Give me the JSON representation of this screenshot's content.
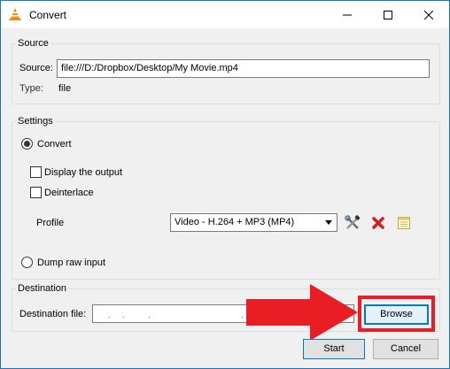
{
  "window": {
    "title": "Convert",
    "accent_color": "#e81e24"
  },
  "source": {
    "legend": "Source",
    "source_label": "Source:",
    "source_value": "file:///D:/Dropbox/Desktop/My Movie.mp4",
    "type_label": "Type:",
    "type_value": "file"
  },
  "settings": {
    "legend": "Settings",
    "convert_label": "Convert",
    "display_output_label": "Display the output",
    "deinterlace_label": "Deinterlace",
    "profile_label": "Profile",
    "profile_selected": "Video - H.264 + MP3 (MP4)",
    "dump_raw_label": "Dump raw input"
  },
  "destination": {
    "legend": "Destination",
    "file_label": "Destination file:",
    "file_value": "",
    "browse_label": "Browse"
  },
  "footer": {
    "start_label": "Start",
    "cancel_label": "Cancel"
  },
  "icons": {
    "app": "vlc-cone-icon",
    "edit_profile": "wrench-screwdriver-icon",
    "delete_profile": "red-x-icon",
    "new_profile": "notepad-icon",
    "annotation": "red-arrow-icon"
  }
}
